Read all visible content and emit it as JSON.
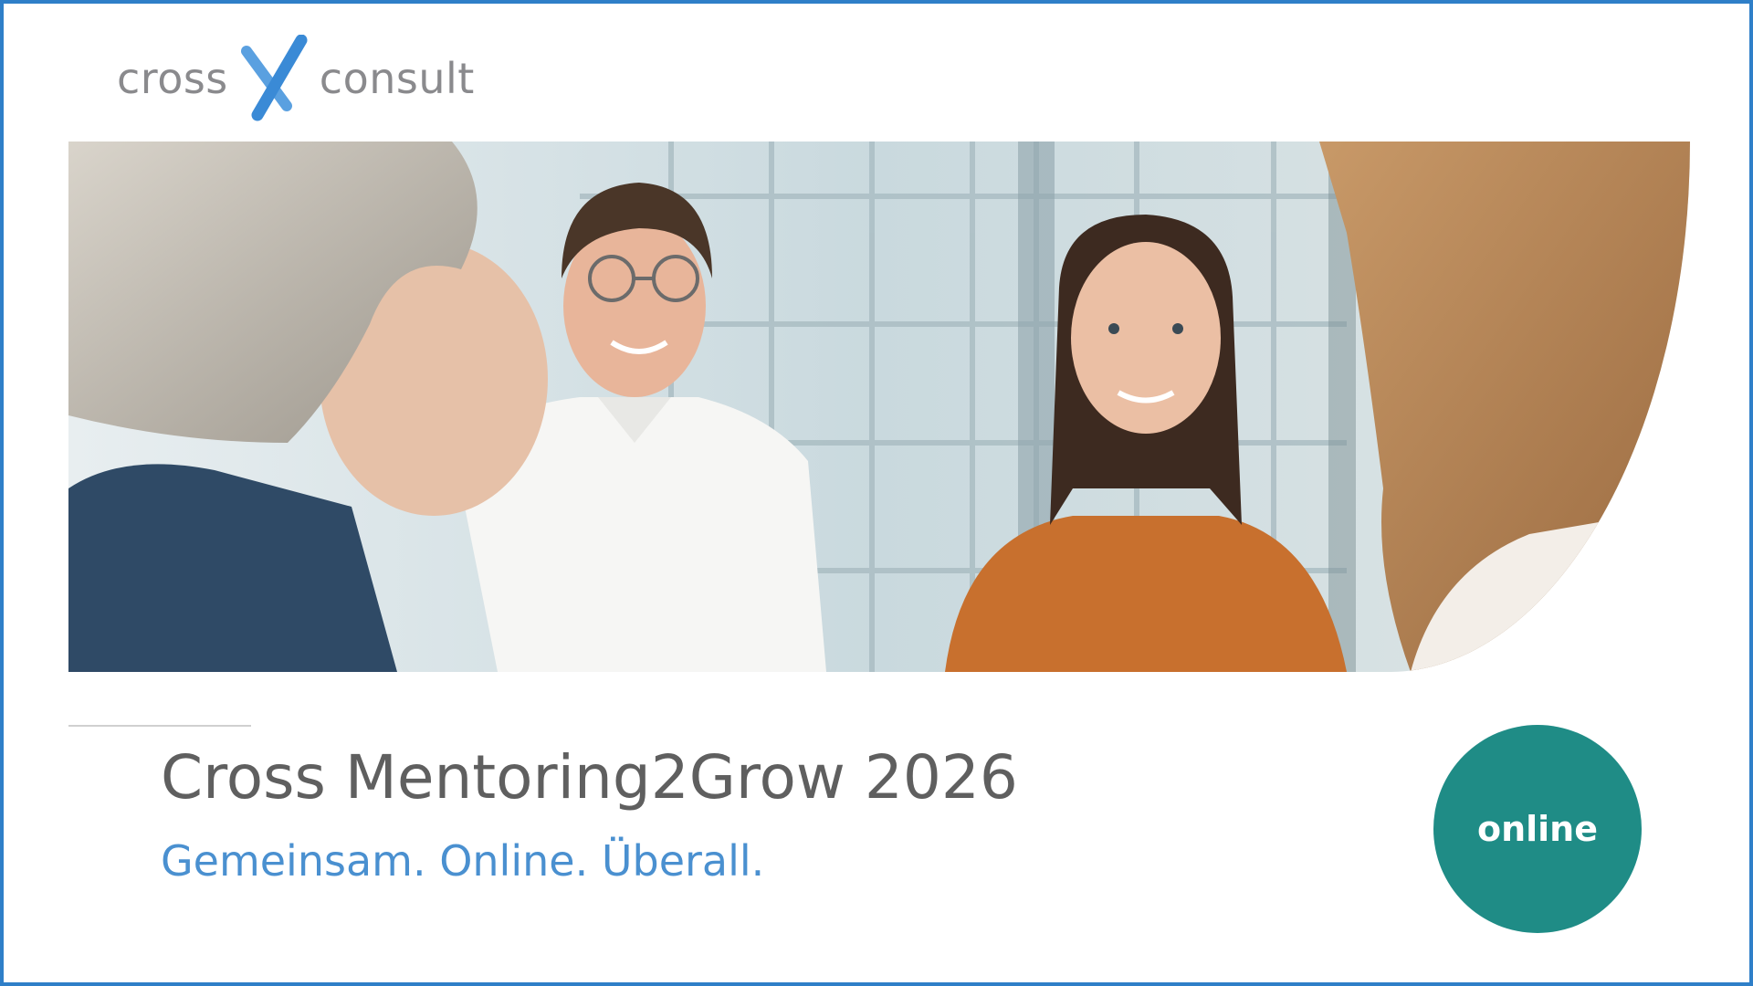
{
  "logo": {
    "left_word": "cross",
    "right_word": "consult",
    "mark": "x-mark-icon",
    "colors": {
      "text": "#8a8a8d",
      "mark": "#3a8ad6"
    }
  },
  "hero": {
    "image": "photo of four colleagues talking in a bright glass office"
  },
  "title": "Cross Mentoring2Grow 2026",
  "subtitle": "Gemeinsam. Online. Überall.",
  "badge": {
    "label": "online",
    "color": "#1f8c86"
  },
  "colors": {
    "frame_border": "#2f7fc8",
    "title_text": "#5f5f5f",
    "subtitle_text": "#4a90d0"
  }
}
